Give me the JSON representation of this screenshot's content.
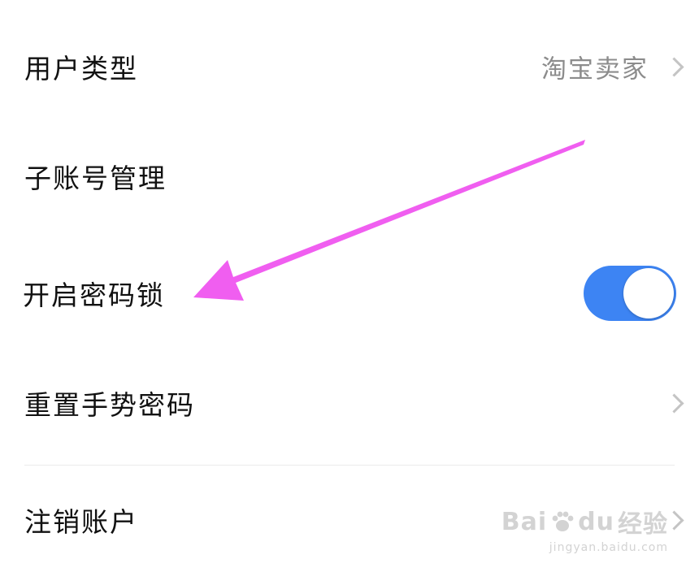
{
  "settings": {
    "rows": [
      {
        "label": "用户类型",
        "value": "淘宝卖家",
        "control": "chevron"
      },
      {
        "label": "子账号管理",
        "value": "",
        "control": "none"
      },
      {
        "label": "开启密码锁",
        "value": "",
        "control": "toggle",
        "toggle_on": true
      },
      {
        "label": "重置手势密码",
        "value": "",
        "control": "chevron"
      },
      {
        "label": "注销账户",
        "value": "",
        "control": "chevron"
      }
    ]
  },
  "annotation": {
    "arrow_color": "#f05ef0",
    "points_to": "开启密码锁"
  },
  "watermark": {
    "brand_prefix": "Bai",
    "brand_suffix": "经验",
    "brand_du": "du",
    "url": "jingyan.baidu.com"
  },
  "colors": {
    "toggle_on": "#3d84f3",
    "text_primary": "#111111",
    "text_secondary": "#8c8c8c",
    "chevron": "#c4c4c4"
  }
}
